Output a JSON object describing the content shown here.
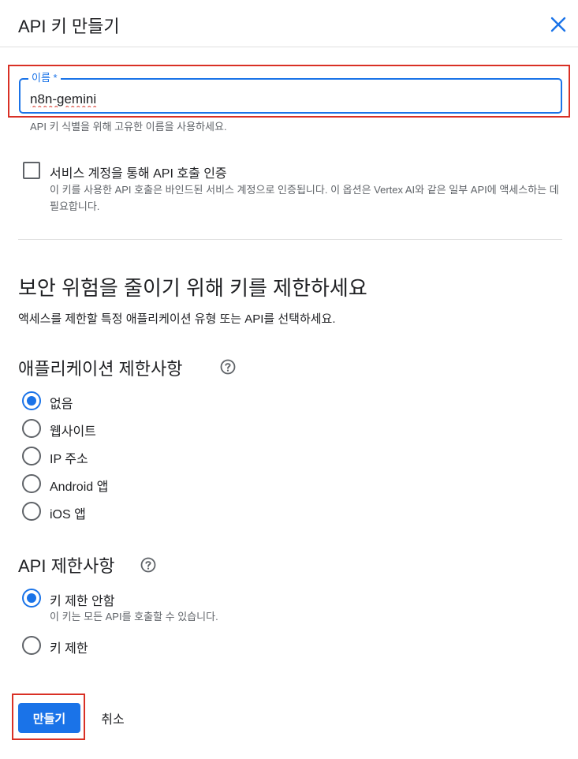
{
  "header": {
    "title": "API 키 만들기",
    "close_icon": "close-icon"
  },
  "name_field": {
    "label": "이름 *",
    "value": "n8n-gemini",
    "hint": "API 키 식별을 위해 고유한 이름을 사용하세요."
  },
  "service_account": {
    "checked": false,
    "label": "서비스 계정을 통해 API 호출 인증",
    "description": "이 키를 사용한 API 호출은 바인드된 서비스 계정으로 인증됩니다. 이 옵션은 Vertex AI와 같은 일부 API에 액세스하는 데 필요합니다."
  },
  "restrict_section": {
    "heading": "보안 위험을 줄이기 위해 키를 제한하세요",
    "description": "액세스를 제한할 특정 애플리케이션 유형 또는 API를 선택하세요."
  },
  "app_restrictions": {
    "heading": "애플리케이션 제한사항",
    "help_icon": "help-circle-icon",
    "options": [
      {
        "label": "없음",
        "selected": true
      },
      {
        "label": "웹사이트",
        "selected": false
      },
      {
        "label": "IP 주소",
        "selected": false
      },
      {
        "label": "Android 앱",
        "selected": false
      },
      {
        "label": "iOS 앱",
        "selected": false
      }
    ]
  },
  "api_restrictions": {
    "heading": "API 제한사항",
    "help_icon": "help-circle-icon",
    "options": [
      {
        "label": "키 제한 안함",
        "description": "이 키는 모든 API를 호출할 수 있습니다.",
        "selected": true
      },
      {
        "label": "키 제한",
        "selected": false
      }
    ]
  },
  "actions": {
    "create_label": "만들기",
    "cancel_label": "취소"
  },
  "colors": {
    "accent": "#1a73e8",
    "highlight": "#d93025",
    "text_primary": "#202124",
    "text_secondary": "#5f6368"
  }
}
